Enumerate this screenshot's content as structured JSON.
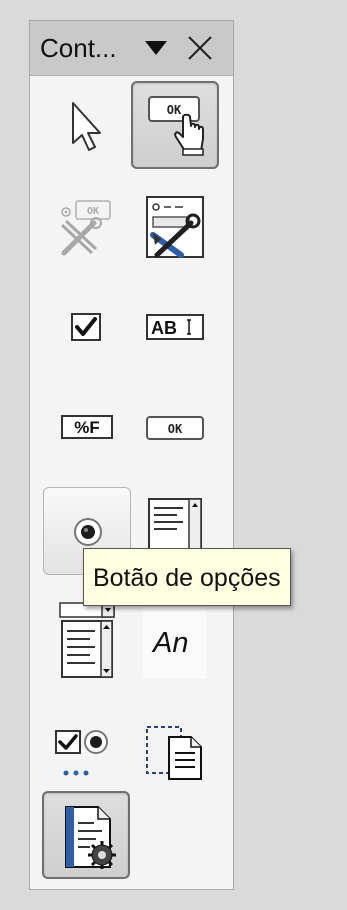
{
  "panel": {
    "title": "Cont...",
    "menu_icon": "dropdown-arrow-icon",
    "close_icon": "close-icon"
  },
  "tools": {
    "select": {
      "icon": "arrow-pointer-icon",
      "state": "normal"
    },
    "test_mode": {
      "icon": "ok-button-hand-cursor-icon",
      "state": "pressed"
    },
    "design_mode": {
      "icon": "design-tools-disabled-icon",
      "state": "disabled"
    },
    "form_properties": {
      "icon": "form-design-tools-icon",
      "state": "normal"
    },
    "check_box": {
      "icon": "checkbox-icon",
      "state": "normal"
    },
    "text_box": {
      "icon": "text-box-icon",
      "label": "AB"
    },
    "formatted_field": {
      "icon": "formatted-field-icon",
      "label": "%F"
    },
    "push_button": {
      "icon": "push-button-icon",
      "label": "OK"
    },
    "option_button": {
      "icon": "radio-button-icon",
      "state": "hovered"
    },
    "list_box": {
      "icon": "list-box-icon",
      "state": "normal"
    },
    "combo_box": {
      "icon": "combo-box-icon",
      "state": "normal"
    },
    "label_field": {
      "icon": "label-field-icon",
      "label": "An"
    },
    "more_controls": {
      "icon": "more-controls-icon",
      "state": "normal"
    },
    "group_box": {
      "icon": "group-box-icon",
      "state": "normal"
    },
    "form_design": {
      "icon": "form-design-icon",
      "state": "pressed"
    }
  },
  "tooltip": {
    "text": "Botão de opções"
  },
  "colors": {
    "panel_bg": "#f4f4f4",
    "titlebar_bg": "#c9c9c9",
    "tooltip_bg": "#ffffe1",
    "accent_blue": "#2b5fa8"
  }
}
